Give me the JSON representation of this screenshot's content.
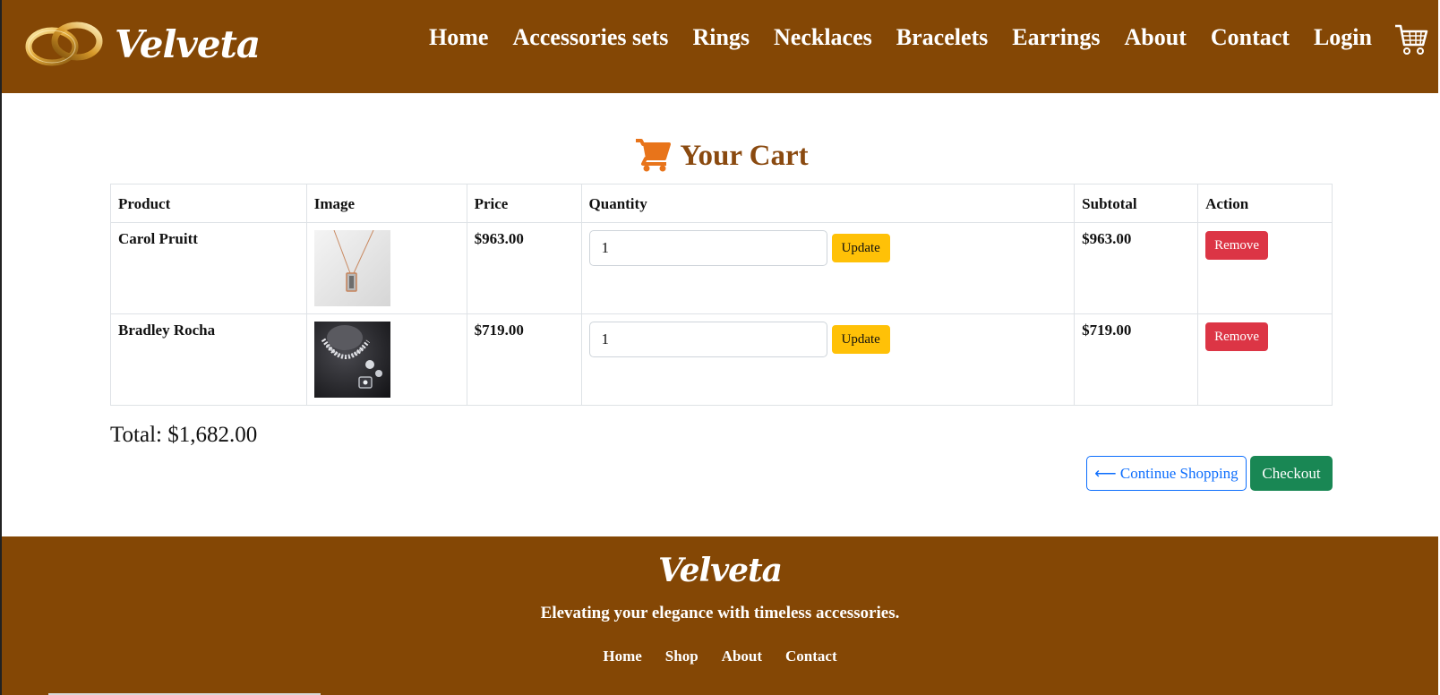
{
  "header": {
    "brand": "Velveta",
    "logo_icon": "wedding-rings-logo",
    "nav": [
      {
        "label": "Home"
      },
      {
        "label": "Accessories sets"
      },
      {
        "label": "Rings"
      },
      {
        "label": "Necklaces"
      },
      {
        "label": "Bracelets"
      },
      {
        "label": "Earrings"
      },
      {
        "label": "About"
      },
      {
        "label": "Contact"
      },
      {
        "label": "Login"
      }
    ],
    "cart_icon": "shopping-cart-icon"
  },
  "main": {
    "title": "Your Cart",
    "title_icon": "shopping-cart-icon",
    "table": {
      "headers": [
        "Product",
        "Image",
        "Price",
        "Quantity",
        "Subtotal",
        "Action"
      ],
      "rows": [
        {
          "product": "Carol Pruitt",
          "image": "rose-gold-pendant-necklace",
          "price": "$963.00",
          "quantity": "1",
          "update_label": "Update",
          "subtotal": "$963.00",
          "remove_label": "Remove"
        },
        {
          "product": "Bradley Rocha",
          "image": "diamond-jewelry-set",
          "price": "$719.00",
          "quantity": "1",
          "update_label": "Update",
          "subtotal": "$719.00",
          "remove_label": "Remove"
        }
      ]
    },
    "total": "Total: $1,682.00",
    "continue_label": "⟵ Continue Shopping",
    "checkout_label": "Checkout"
  },
  "footer": {
    "brand": "Velveta",
    "tagline": "Elevating your elegance with timeless accessories.",
    "links": [
      {
        "label": "Home"
      },
      {
        "label": "Shop"
      },
      {
        "label": "About"
      },
      {
        "label": "Contact"
      }
    ]
  },
  "colors": {
    "brand_brown": "#844705",
    "title_brown": "#8a4a10",
    "cart_orange": "#e8741a",
    "update_yellow": "#ffc107",
    "remove_red": "#dc3545",
    "checkout_green": "#198754",
    "link_blue": "#0d6efd"
  }
}
